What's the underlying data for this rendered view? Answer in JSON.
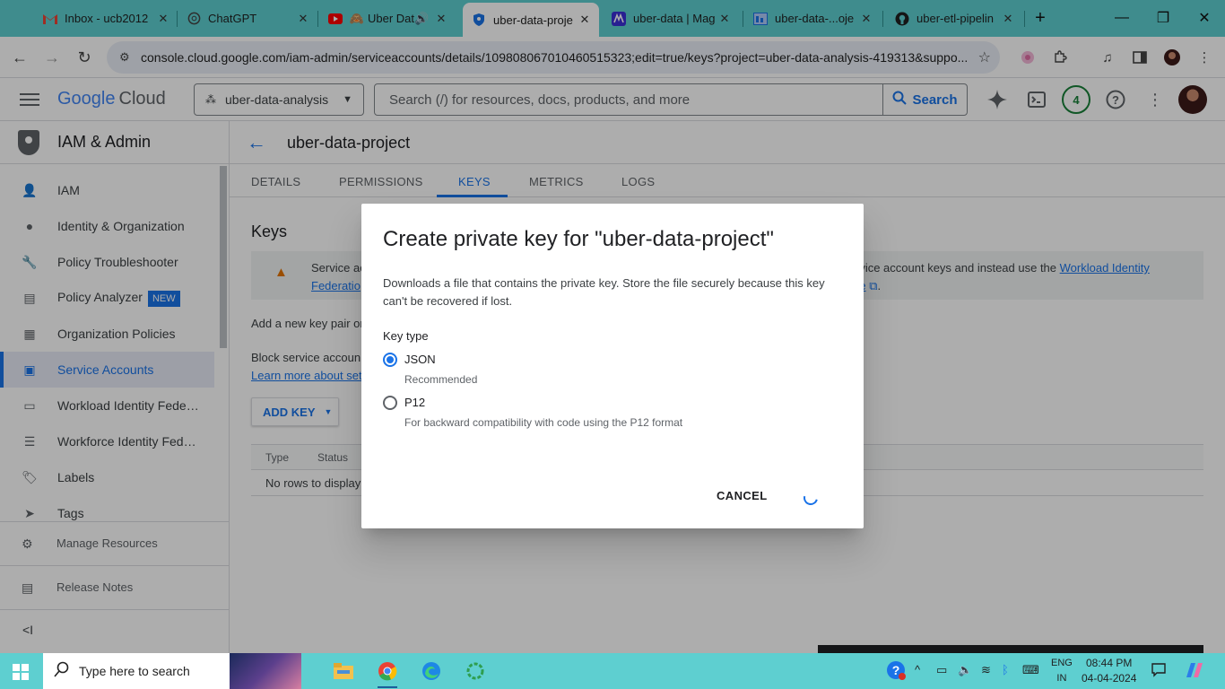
{
  "browser": {
    "tabs": [
      {
        "title": "Inbox - ucb2012",
        "icon": "gmail-icon"
      },
      {
        "title": "ChatGPT",
        "icon": "chatgpt-icon"
      },
      {
        "title": "Uber Dat",
        "icon": "youtube-icon"
      },
      {
        "title": "uber-data-proje",
        "icon": "gcp-shield-icon",
        "active": true
      },
      {
        "title": "uber-data | Mag",
        "icon": "mage-icon"
      },
      {
        "title": "uber-data-...oje",
        "icon": "looker-icon"
      },
      {
        "title": "uber-etl-pipelin",
        "icon": "github-icon"
      }
    ],
    "url": "console.cloud.google.com/iam-admin/serviceaccounts/details/109808067010460515323;edit=true/keys?project=uber-data-analysis-419313&suppo..."
  },
  "header": {
    "logo_google": "Google",
    "logo_cloud": "Cloud",
    "project": "uber-data-analysis",
    "search_placeholder": "Search (/) for resources, docs, products, and more",
    "search_button": "Search",
    "notifications_count": "4"
  },
  "sidebar": {
    "title": "IAM & Admin",
    "items": [
      {
        "label": "IAM",
        "icon": "person-add-icon"
      },
      {
        "label": "Identity & Organization",
        "icon": "account-circle-icon"
      },
      {
        "label": "Policy Troubleshooter",
        "icon": "wrench-icon"
      },
      {
        "label": "Policy Analyzer",
        "icon": "policy-analyzer-icon",
        "badge": "NEW"
      },
      {
        "label": "Organization Policies",
        "icon": "list-doc-icon"
      },
      {
        "label": "Service Accounts",
        "icon": "service-account-icon",
        "active": true
      },
      {
        "label": "Workload Identity Federat...",
        "icon": "id-card-icon"
      },
      {
        "label": "Workforce Identity Federa...",
        "icon": "list-icon"
      },
      {
        "label": "Labels",
        "icon": "label-icon"
      },
      {
        "label": "Tags",
        "icon": "tag-icon"
      }
    ],
    "footer": [
      {
        "label": "Manage Resources",
        "icon": "settings-box-icon"
      },
      {
        "label": "Release Notes",
        "icon": "notes-icon"
      }
    ]
  },
  "page": {
    "title": "uber-data-project",
    "tabs": [
      "DETAILS",
      "PERMISSIONS",
      "KEYS",
      "METRICS",
      "LOGS"
    ],
    "active_tab": "KEYS",
    "keys_heading": "Keys",
    "warning_left_1": "Service ac",
    "warning_left_2": "Federatio",
    "warning_right_1": "rvice account keys and instead use the ",
    "warning_link_1": "Workload Identity",
    "warning_link_2": "re",
    "add_key_pair_text": "Add a new key pair or",
    "block_text": "Block service accoun",
    "learn_more": "Learn more about set",
    "add_key_button": "ADD KEY",
    "table_columns": [
      "Type",
      "Status"
    ],
    "table_empty": "No rows to display"
  },
  "dialog": {
    "title": "Create private key for \"uber-data-project\"",
    "description": "Downloads a file that contains the private key. Store the file securely because this key can't be recovered if lost.",
    "key_type_label": "Key type",
    "options": [
      {
        "label": "JSON",
        "help": "Recommended",
        "selected": true
      },
      {
        "label": "P12",
        "help": "For backward compatibility with code using the P12 format",
        "selected": false
      }
    ],
    "cancel": "CANCEL"
  },
  "taskbar": {
    "search_placeholder": "Type here to search",
    "lang_top": "ENG",
    "lang_bottom": "IN",
    "time": "08:44 PM",
    "date": "04-04-2024"
  },
  "colors": {
    "accent": "#1a73e8",
    "chrome_frame": "#5ecfd0",
    "warning": "#e37400"
  }
}
